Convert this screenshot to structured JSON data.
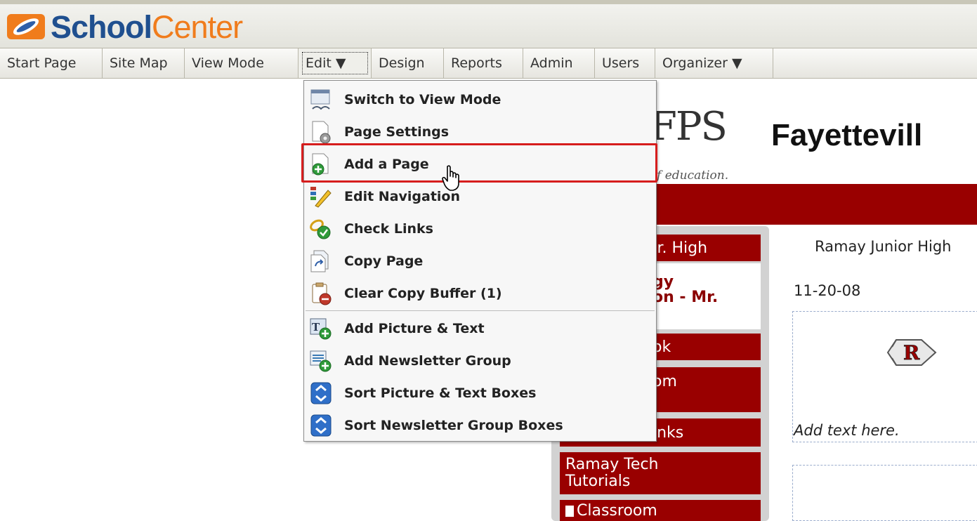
{
  "app": {
    "logo_part1": "School",
    "logo_part2": "Center",
    "brand_blue": "#1f4f8f",
    "brand_orange": "#f07c1c"
  },
  "menubar": {
    "items": [
      {
        "label": "Start Page"
      },
      {
        "label": "Site Map"
      },
      {
        "label": "View Mode"
      },
      {
        "label": "Edit ▼",
        "active": true
      },
      {
        "label": "Design"
      },
      {
        "label": "Reports"
      },
      {
        "label": "Admin"
      },
      {
        "label": "Users"
      },
      {
        "label": "Organizer ▼"
      }
    ]
  },
  "edit_menu": {
    "items": [
      {
        "label": "Switch to View Mode",
        "icon": "view-mode-icon"
      },
      {
        "label": "Page Settings",
        "icon": "page-settings-icon"
      },
      {
        "label": "Add a Page",
        "icon": "add-page-icon",
        "highlighted": true
      },
      {
        "label": "Edit Navigation",
        "icon": "edit-navigation-icon"
      },
      {
        "label": "Check Links",
        "icon": "check-links-icon"
      },
      {
        "label": "Copy Page",
        "icon": "copy-page-icon"
      },
      {
        "label": "Clear Copy Buffer (1)",
        "icon": "clear-buffer-icon"
      },
      {
        "label": "Add Picture & Text",
        "icon": "add-picture-text-icon"
      },
      {
        "label": "Add Newsletter Group",
        "icon": "add-newsletter-icon"
      },
      {
        "label": "Sort Picture & Text Boxes",
        "icon": "sort-icon"
      },
      {
        "label": "Sort Newsletter Group Boxes",
        "icon": "sort-icon"
      }
    ],
    "highlight_color": "#d61d1d"
  },
  "page": {
    "fps_logo": "FPS",
    "fps_tagline": "f education.",
    "site_title": "Fayettevill",
    "accent": "#990000",
    "nav": {
      "item1": "Jr. High",
      "item2_line1": "gy",
      "item2_line2": "on - Mr.",
      "item3": "ok",
      "item4": "om",
      "item5": "inks",
      "item6_line1": "Ramay Tech",
      "item6_line2": "Tutorials",
      "item7": "Classroom"
    },
    "content": {
      "heading": "Ramay Junior High",
      "date": "11-20-08",
      "placeholder": "Add text here."
    }
  }
}
